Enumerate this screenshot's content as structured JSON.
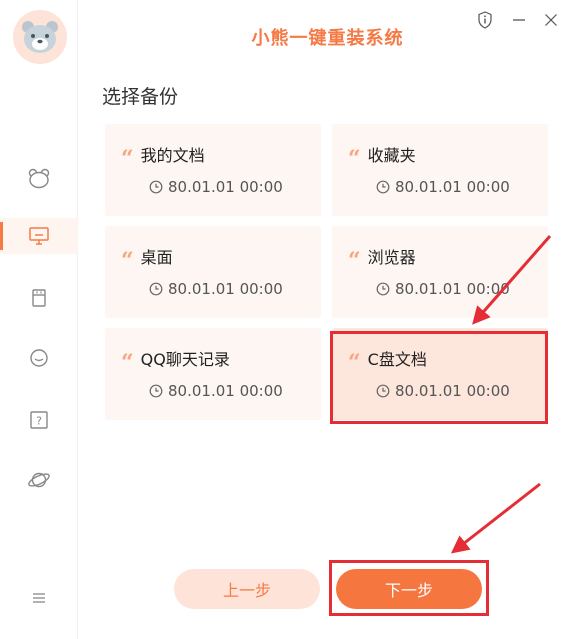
{
  "window": {
    "title": "小熊一键重装系统",
    "controls": [
      "info-icon",
      "minimize-icon",
      "close-icon"
    ]
  },
  "sidebar": {
    "items": [
      {
        "icon": "bear-icon",
        "active": false
      },
      {
        "icon": "monitor-icon",
        "active": true
      },
      {
        "icon": "usb-drive-icon",
        "active": false
      },
      {
        "icon": "chat-icon",
        "active": false
      },
      {
        "icon": "help-icon",
        "active": false
      },
      {
        "icon": "planet-icon",
        "active": false
      }
    ],
    "menu_icon": "menu-icon"
  },
  "main": {
    "section_title": "选择备份",
    "cards": [
      {
        "name": "我的文档",
        "time": "80.01.01 00:00",
        "selected": false
      },
      {
        "name": "收藏夹",
        "time": "80.01.01 00:00",
        "selected": false
      },
      {
        "name": "桌面",
        "time": "80.01.01 00:00",
        "selected": false
      },
      {
        "name": "浏览器",
        "time": "80.01.01 00:00",
        "selected": false
      },
      {
        "name": "QQ聊天记录",
        "time": "80.01.01 00:00",
        "selected": false
      },
      {
        "name": "C盘文档",
        "time": "80.01.01 00:00",
        "selected": true
      }
    ],
    "prev_label": "上一步",
    "next_label": "下一步"
  },
  "colors": {
    "accent": "#f57a45",
    "accent_light": "#fde3d8",
    "card_bg": "#fdf6f3",
    "annotation": "#e42d34"
  }
}
